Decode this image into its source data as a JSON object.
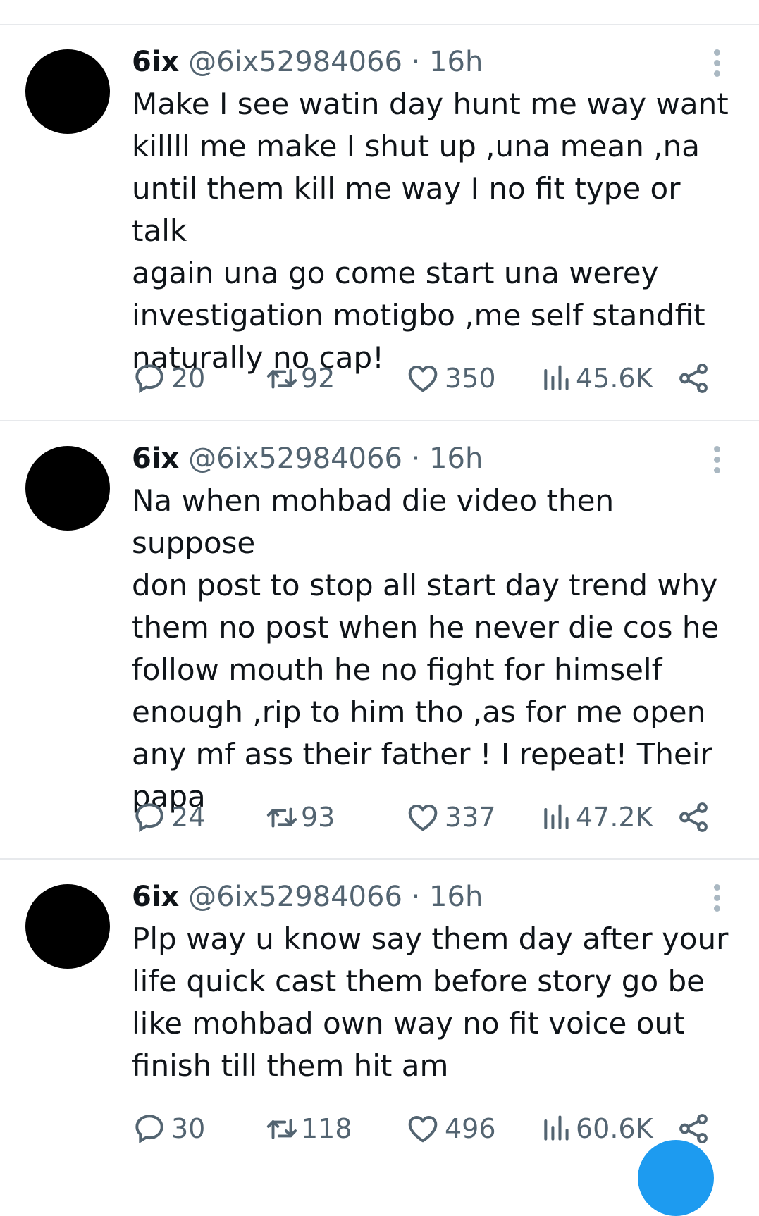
{
  "tweets": [
    {
      "name": "6ix",
      "handle": "@6ix52984066",
      "time": "16h",
      "text": "Make I see watin day hunt me way want\nkillll me make I shut up ,una mean ,na\nuntil them kill me way I no fit type or talk\nagain una go come start una werey\ninvestigation motigbo ,me self standfit\nnaturally no cap!",
      "replies": "20",
      "reposts": "92",
      "likes": "350",
      "views": "45.6K"
    },
    {
      "name": "6ix",
      "handle": "@6ix52984066",
      "time": "16h",
      "text": "Na when mohbad die video then suppose\ndon post to stop all start day trend why\nthem no post when he never die cos he\nfollow mouth he no fight for himself\nenough ,rip to him tho ,as for me open\nany mf ass their father ! I repeat! Their\npapa",
      "replies": "24",
      "reposts": "93",
      "likes": "337",
      "views": "47.2K"
    },
    {
      "name": "6ix",
      "handle": "@6ix52984066",
      "time": "16h",
      "text": "Plp way u know say them day after your\nlife quick cast them before story go be\nlike mohbad own way no fit voice out\nfinish till them hit am",
      "replies": "30",
      "reposts": "118",
      "likes": "496",
      "views": "60.6K"
    }
  ],
  "separator": " · ",
  "icons": {
    "reply": "reply-icon",
    "repost": "repost-icon",
    "like": "heart-icon",
    "views": "views-icon",
    "share": "share-icon",
    "more": "more-vertical-icon"
  },
  "colors": {
    "text": "#0f1419",
    "muted": "#536471",
    "accent": "#1d9bf0",
    "divider": "#e7e9ec"
  }
}
